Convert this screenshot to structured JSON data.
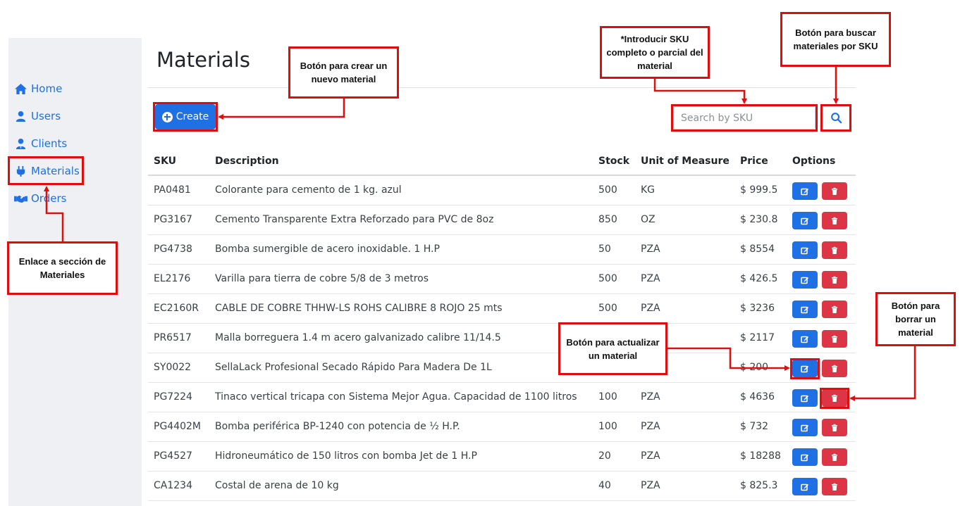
{
  "sidebar": {
    "items": [
      {
        "label": "Home",
        "icon": "home-icon"
      },
      {
        "label": "Users",
        "icon": "user-icon"
      },
      {
        "label": "Clients",
        "icon": "user-tie-icon"
      },
      {
        "label": "Materials",
        "icon": "plug-icon"
      },
      {
        "label": "Orders",
        "icon": "handshake-icon"
      }
    ]
  },
  "page": {
    "title": "Materials",
    "create_label": "Create",
    "search_placeholder": "Search by SKU"
  },
  "table": {
    "headers": [
      "SKU",
      "Description",
      "Stock",
      "Unit of Measure",
      "Price",
      "Options"
    ],
    "rows": [
      {
        "sku": "PA0481",
        "description": "Colorante para cemento de 1 kg. azul",
        "stock": "500",
        "unit": "KG",
        "price": "$ 999.5"
      },
      {
        "sku": "PG3167",
        "description": "Cemento Transparente Extra Reforzado para PVC de 8oz",
        "stock": "850",
        "unit": "OZ",
        "price": "$ 230.8"
      },
      {
        "sku": "PG4738",
        "description": "Bomba sumergible de acero inoxidable. 1 H.P",
        "stock": "50",
        "unit": "PZA",
        "price": "$ 8554"
      },
      {
        "sku": "EL2176",
        "description": "Varilla para tierra de cobre 5/8 de 3 metros",
        "stock": "500",
        "unit": "PZA",
        "price": "$ 426.5"
      },
      {
        "sku": "EC2160R",
        "description": "CABLE DE COBRE THHW-LS ROHS CALIBRE 8 ROJO 25 mts",
        "stock": "500",
        "unit": "PZA",
        "price": "$ 3236"
      },
      {
        "sku": "PR6517",
        "description": "Malla borreguera 1.4 m acero galvanizado calibre 11/14.5",
        "stock": "",
        "unit": "",
        "price": "$ 2117"
      },
      {
        "sku": "SY0022",
        "description": "SellaLack Profesional Secado Rápido Para Madera De 1L",
        "stock": "",
        "unit": "",
        "price": "$ 200"
      },
      {
        "sku": "PG7224",
        "description": "Tinaco vertical tricapa con Sistema Mejor Agua. Capacidad de 1100 litros",
        "stock": "100",
        "unit": "PZA",
        "price": "$ 4636"
      },
      {
        "sku": "PG4402M",
        "description": "Bomba periférica BP-1240 con potencia de ½ H.P.",
        "stock": "100",
        "unit": "PZA",
        "price": "$ 732"
      },
      {
        "sku": "PG4527",
        "description": "Hidroneumático de 150 litros con bomba Jet de 1 H.P",
        "stock": "20",
        "unit": "PZA",
        "price": "$ 18288"
      },
      {
        "sku": "CA1234",
        "description": "Costal de arena de 10 kg",
        "stock": "40",
        "unit": "PZA",
        "price": "$ 825.3"
      }
    ]
  },
  "annotations": {
    "materials_link": "Enlace a sección de Materiales",
    "create_button": "Botón para crear un nuevo material",
    "search_input": "*Introducir SKU completo o parcial del material",
    "search_button": "Botón para buscar materiales por SKU",
    "update_button": "Botón para actualizar un material",
    "delete_button": "Botón para borrar un material"
  },
  "colors": {
    "primary": "#1f6fe5",
    "danger": "#dc3545",
    "annotation": "#e00d0d",
    "sidebar_bg": "#eef0f3"
  }
}
